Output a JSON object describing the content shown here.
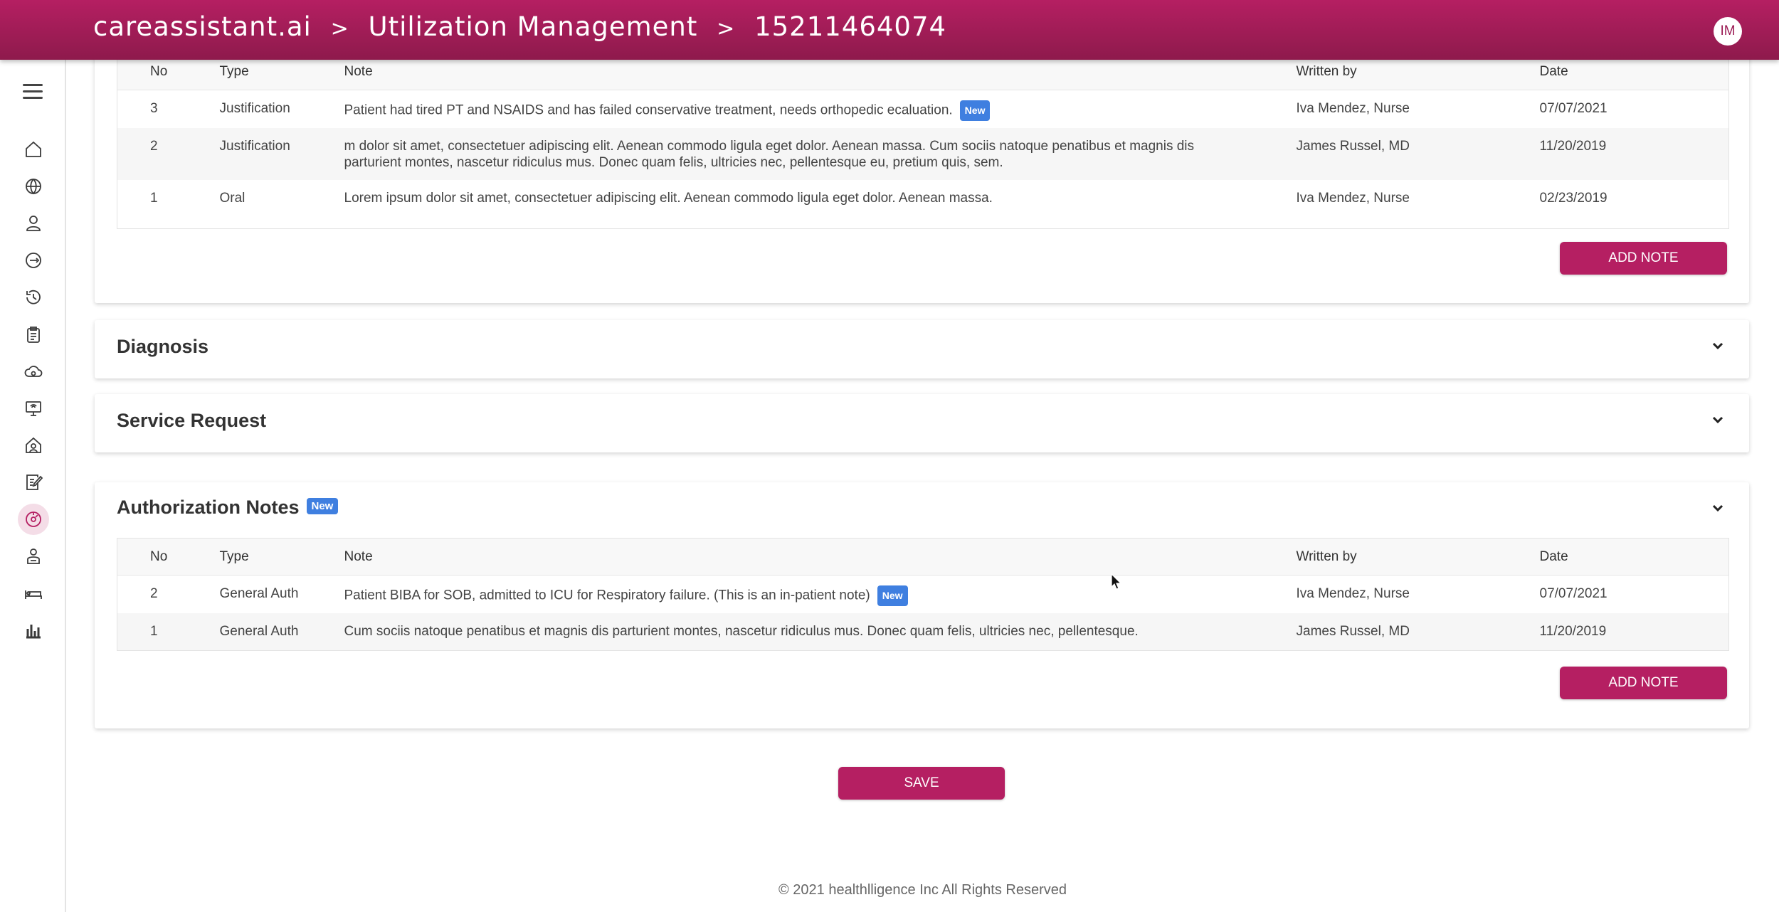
{
  "header": {
    "brand": "careassistant.ai",
    "separator": ">",
    "section": "Utilization Management",
    "record_id": "15211464074",
    "avatar_initials": "IM"
  },
  "sidebar": {
    "items": [
      {
        "icon": "home-icon"
      },
      {
        "icon": "globe-icon"
      },
      {
        "icon": "users-icon"
      },
      {
        "icon": "view-360-icon"
      },
      {
        "icon": "history-icon"
      },
      {
        "icon": "clipboard-icon"
      },
      {
        "icon": "cloud-settings-icon"
      },
      {
        "icon": "monitor-wifi-icon"
      },
      {
        "icon": "home-care-icon"
      },
      {
        "icon": "edit-document-icon"
      },
      {
        "icon": "utilization-icon",
        "active": true
      },
      {
        "icon": "caregiver-icon"
      },
      {
        "icon": "bed-icon"
      },
      {
        "icon": "bar-chart-icon"
      }
    ]
  },
  "columns": {
    "no": "No",
    "type": "Type",
    "note": "Note",
    "written_by": "Written by",
    "date": "Date"
  },
  "new_badge": "New",
  "clinical_notes": {
    "rows": [
      {
        "no": "3",
        "type": "Justification",
        "note": "Patient had tired PT and NSAIDS and has failed conservative treatment, needs orthopedic ecaluation.",
        "is_new": true,
        "written_by": "Iva Mendez, Nurse",
        "date": "07/07/2021"
      },
      {
        "no": "2",
        "type": "Justification",
        "note": "m dolor sit amet, consectetuer adipiscing elit. Aenean commodo ligula eget dolor. Aenean massa. Cum sociis natoque penatibus et magnis dis parturient montes, nascetur ridiculus mus. Donec quam felis, ultricies nec, pellentesque eu, pretium quis, sem.",
        "is_new": false,
        "written_by": "James Russel, MD",
        "date": "11/20/2019"
      },
      {
        "no": "1",
        "type": "Oral",
        "note": "Lorem ipsum dolor sit amet, consectetuer adipiscing elit. Aenean commodo ligula eget dolor. Aenean massa.",
        "is_new": false,
        "written_by": "Iva Mendez, Nurse",
        "date": "02/23/2019"
      }
    ],
    "add_note_label": "ADD NOTE"
  },
  "diagnosis": {
    "title": "Diagnosis"
  },
  "service_request": {
    "title": "Service Request"
  },
  "authorization_notes": {
    "title": "Authorization Notes",
    "rows": [
      {
        "no": "2",
        "type": "General Auth",
        "note": "Patient BIBA for SOB, admitted to ICU for Respiratory failure. (This is an in-patient note)",
        "is_new": true,
        "written_by": "Iva Mendez, Nurse",
        "date": "07/07/2021"
      },
      {
        "no": "1",
        "type": "General Auth",
        "note": "Cum sociis natoque penatibus et magnis dis parturient montes, nascetur ridiculus mus. Donec quam felis, ultricies nec, pellentesque.",
        "is_new": false,
        "written_by": "James Russel, MD",
        "date": "11/20/2019"
      }
    ],
    "add_note_label": "ADD NOTE"
  },
  "save_label": "SAVE",
  "footer": "© 2021 healthlligence Inc All Rights Reserved"
}
